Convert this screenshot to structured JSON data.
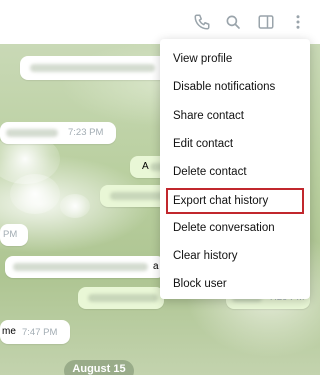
{
  "header": {
    "icons": [
      "phone-icon",
      "search-icon",
      "sidebar-icon",
      "more-vert-icon"
    ]
  },
  "menu": {
    "items": [
      {
        "label": "View profile"
      },
      {
        "label": "Disable notifications"
      },
      {
        "label": "Share contact"
      },
      {
        "label": "Edit contact"
      },
      {
        "label": "Delete contact"
      },
      {
        "label": "Export chat history",
        "highlighted": true
      },
      {
        "label": "Delete conversation"
      },
      {
        "label": "Clear history"
      },
      {
        "label": "Block user"
      }
    ],
    "highlight_color": "#c1272d"
  },
  "messages": [
    {
      "time": "7:23 PM"
    },
    {
      "time": "PM"
    },
    {
      "text": "me",
      "time": "7:47 PM"
    },
    {
      "text": "A"
    },
    {
      "text": "a"
    },
    {
      "time": "7:29 PM"
    }
  ],
  "date_separator": "August 15",
  "colors": {
    "icon": "#9aa4ab",
    "bubble_in": "#ffffff",
    "bubble_out": "#e9f7d6"
  }
}
